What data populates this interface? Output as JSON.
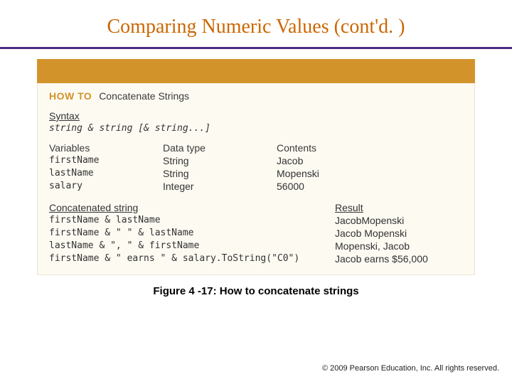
{
  "title": "Comparing Numeric Values (cont'd. )",
  "howto": {
    "label": "HOW TO",
    "text": "Concatenate Strings"
  },
  "syntax": {
    "label": "Syntax",
    "code": "string & string [& string...]"
  },
  "vars": {
    "headers": {
      "c1": "Variables",
      "c2": "Data type",
      "c3": "Contents"
    },
    "rows": [
      {
        "c1": "firstName",
        "c2": "String",
        "c3": "Jacob"
      },
      {
        "c1": "lastName",
        "c2": "String",
        "c3": "Mopenski"
      },
      {
        "c1": "salary",
        "c2": "Integer",
        "c3": "56000"
      }
    ]
  },
  "concat": {
    "headers": {
      "left": "Concatenated string",
      "right": "Result"
    },
    "rows": [
      {
        "expr": "firstName & lastName",
        "result": "JacobMopenski"
      },
      {
        "expr": "firstName & \" \" & lastName",
        "result": "Jacob Mopenski"
      },
      {
        "expr": "lastName & \", \" & firstName",
        "result": "Mopenski, Jacob"
      },
      {
        "expr": "firstName & \" earns \" & salary.ToString(\"C0\")",
        "result": "Jacob earns $56,000"
      }
    ]
  },
  "caption": "Figure 4 -17: How to concatenate strings",
  "copyright": "2009 Pearson Education, Inc.  All rights reserved."
}
